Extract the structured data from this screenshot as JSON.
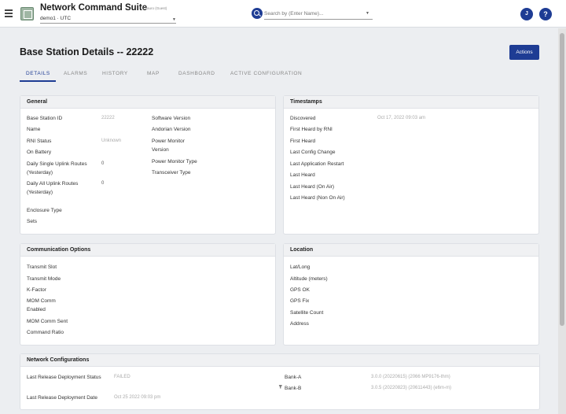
{
  "header": {
    "app_title": "Network Command Suite",
    "app_subtitle": "t.bauro (Guest)",
    "environment": "demo1 · UTC",
    "search_placeholder": "Search by (Enter Name)...",
    "user_initial": "J",
    "help_symbol": "?"
  },
  "page": {
    "title": "Base Station Details -- 22222",
    "actions_label": "Actions"
  },
  "tabs": [
    {
      "label": "DETAILS",
      "active": true
    },
    {
      "label": "ALARMS",
      "active": false
    },
    {
      "label": "HISTORY",
      "active": false
    },
    {
      "label": "MAP",
      "active": false
    },
    {
      "label": "DASHBOARD",
      "active": false
    },
    {
      "label": "ACTIVE CONFIGURATION",
      "active": false
    }
  ],
  "general": {
    "title": "General",
    "left": [
      {
        "label": "Base Station ID",
        "value": "22222"
      },
      {
        "label": "Name",
        "value": ""
      },
      {
        "label": "RNI Status",
        "value": "Unknown"
      },
      {
        "label": "On Battery",
        "value": ""
      },
      {
        "label": "Daily Single Uplink Routes (Yesterday)",
        "value": "0"
      },
      {
        "label": "Daily All Uplink Routes (Yesterday)",
        "value": "0"
      },
      {
        "label": "Enclosure Type",
        "value": ""
      },
      {
        "label": "Sets",
        "value": ""
      }
    ],
    "right": [
      {
        "label": "Software Version",
        "value": ""
      },
      {
        "label": "Andorian Version",
        "value": ""
      },
      {
        "label": "Power Monitor Version",
        "value": ""
      },
      {
        "label": "Power Monitor Type",
        "value": ""
      },
      {
        "label": "Transceiver Type",
        "value": ""
      }
    ]
  },
  "timestamps": {
    "title": "Timestamps",
    "rows": [
      {
        "label": "Discovered",
        "value": "Oct 17, 2022 09:03 am"
      },
      {
        "label": "First Heard by RNI",
        "value": ""
      },
      {
        "label": "First Heard",
        "value": ""
      },
      {
        "label": "Last Config Change",
        "value": ""
      },
      {
        "label": "Last Application Restart",
        "value": ""
      },
      {
        "label": "Last Heard",
        "value": ""
      },
      {
        "label": "Last Heard (On Air)",
        "value": ""
      },
      {
        "label": "Last Heard (Non On Air)",
        "value": ""
      }
    ]
  },
  "communication": {
    "title": "Communication Options",
    "rows": [
      {
        "label": "Transmit Slot",
        "value": ""
      },
      {
        "label": "Transmit Mode",
        "value": ""
      },
      {
        "label": "K-Factor",
        "value": ""
      },
      {
        "label": "MOM Comm Enabled",
        "value": ""
      },
      {
        "label": "MOM Comm Sent",
        "value": ""
      },
      {
        "label": "Command Ratio",
        "value": ""
      }
    ]
  },
  "location": {
    "title": "Location",
    "rows": [
      {
        "label": "Lat/Long",
        "value": ""
      },
      {
        "label": "Altitude (meters)",
        "value": ""
      },
      {
        "label": "GPS OK",
        "value": ""
      },
      {
        "label": "GPS Fix",
        "value": ""
      },
      {
        "label": "Satellite Count",
        "value": ""
      },
      {
        "label": "Address",
        "value": ""
      }
    ]
  },
  "network_config": {
    "title": "Network Configurations",
    "left": [
      {
        "label": "Last Release Deployment Status",
        "value": "FAILED"
      },
      {
        "label": "Last Release Deployment Date",
        "value": "Oct 25 2022 09:03 pm"
      }
    ],
    "banks": [
      {
        "label": "Bank-A",
        "value": "3.0.0 (20220615) (2066 MP9176-thm)"
      },
      {
        "label": "Bank-B",
        "value": "3.0.5 (20220823) (20611443) (e6m-m)"
      }
    ]
  }
}
